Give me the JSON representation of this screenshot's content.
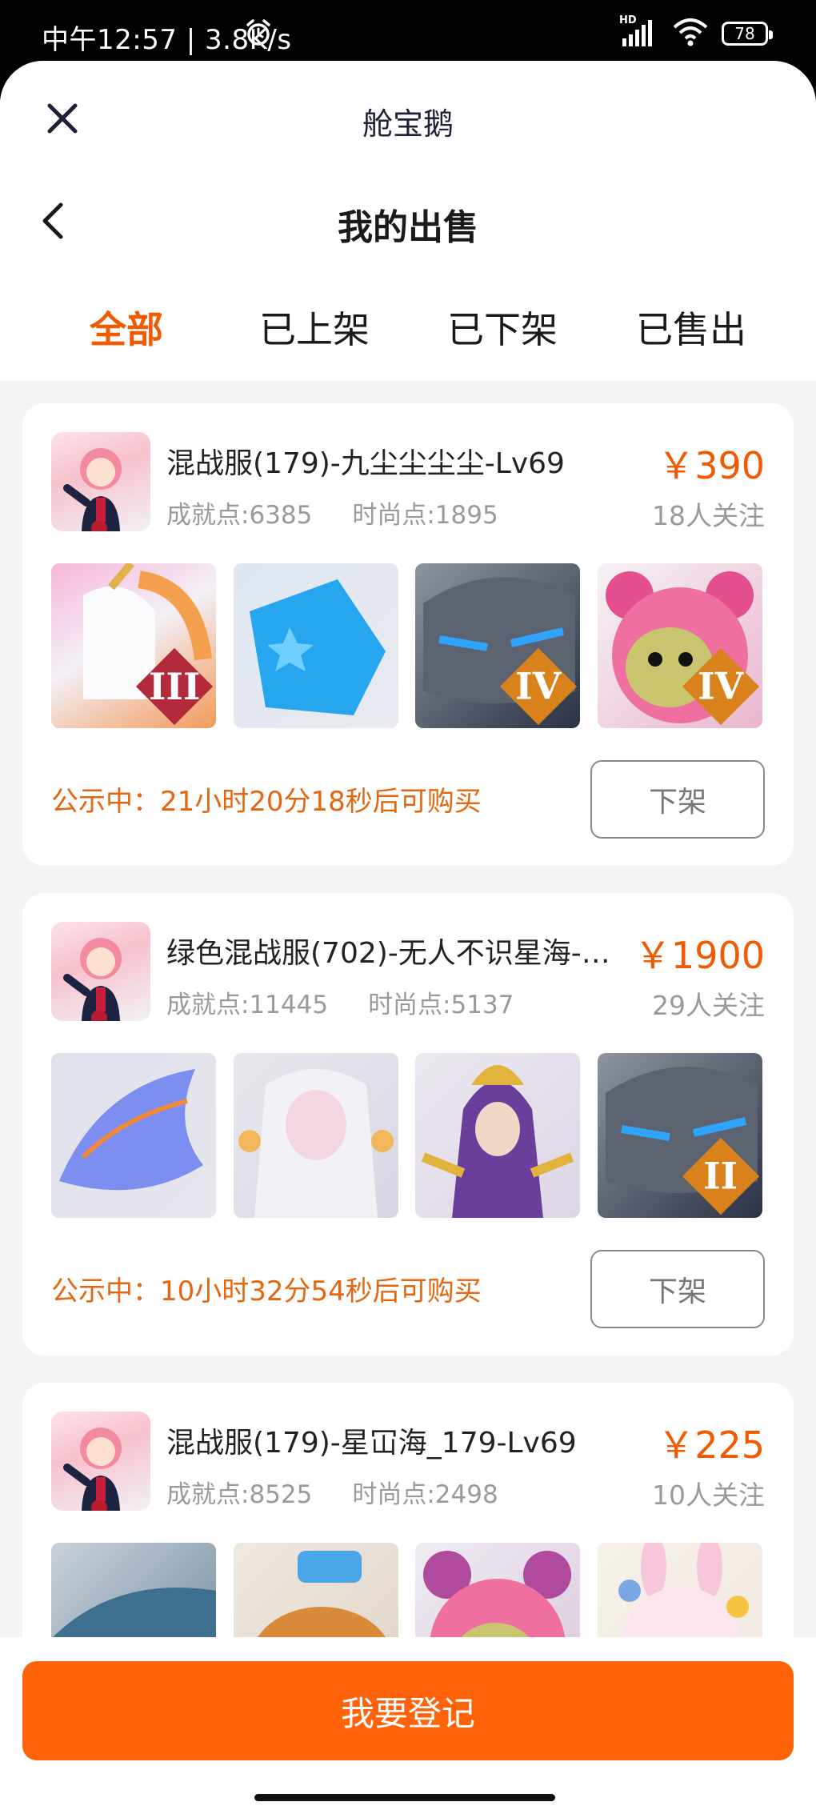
{
  "status_bar": {
    "time": "中午12:57 | 3.8K/s",
    "signal_label": "HD",
    "battery": "78"
  },
  "header": {
    "app_title": "舱宝鹅",
    "page_title": "我的出售"
  },
  "tabs": [
    {
      "label": "全部",
      "active": true
    },
    {
      "label": "已上架",
      "active": false
    },
    {
      "label": "已下架",
      "active": false
    },
    {
      "label": "已售出",
      "active": false
    }
  ],
  "listings": [
    {
      "title": "混战服(179)-九尘尘尘尘-Lv69",
      "achievement": "成就点:6385",
      "fashion": "时尚点:1895",
      "price": "￥390",
      "followers": "18人关注",
      "items": [
        {
          "icon": "unicorn",
          "badge": "III",
          "badge_color": "#b32a3a"
        },
        {
          "icon": "blue-star-pillow",
          "badge": "",
          "badge_color": ""
        },
        {
          "icon": "stone-mask",
          "badge": "IV",
          "badge_color": "#d9821c"
        },
        {
          "icon": "pink-bear-hood",
          "badge": "IV",
          "badge_color": "#d9821c"
        }
      ],
      "notice": "公示中：21小时20分18秒后可购买",
      "action_label": "下架"
    },
    {
      "title": "绿色混战服(702)-无人不识星海-…",
      "achievement": "成就点:11445",
      "fashion": "时尚点:5137",
      "price": "￥1900",
      "followers": "29人关注",
      "items": [
        {
          "icon": "purple-dragon",
          "badge": "",
          "badge_color": ""
        },
        {
          "icon": "white-mermaid",
          "badge": "",
          "badge_color": ""
        },
        {
          "icon": "golden-goddess",
          "badge": "",
          "badge_color": ""
        },
        {
          "icon": "stone-mask",
          "badge": "II",
          "badge_color": "#d9821c"
        }
      ],
      "notice": "公示中：10小时32分54秒后可购买",
      "action_label": "下架"
    },
    {
      "title": "混战服(179)-星冚海_179-Lv69",
      "achievement": "成就点:8525",
      "fashion": "时尚点:2498",
      "price": "￥225",
      "followers": "10人关注",
      "items": [
        {
          "icon": "ice-dragon",
          "badge": "",
          "badge_color": ""
        },
        {
          "icon": "cat-with-hat",
          "badge": "",
          "badge_color": ""
        },
        {
          "icon": "pink-bear-hood",
          "badge": "",
          "badge_color": ""
        },
        {
          "icon": "pink-bunny",
          "badge": "",
          "badge_color": ""
        }
      ]
    }
  ],
  "register_button": "我要登记",
  "colors": {
    "accent": "#ff6309",
    "notice": "#e8650f",
    "price": "#f05a00"
  }
}
